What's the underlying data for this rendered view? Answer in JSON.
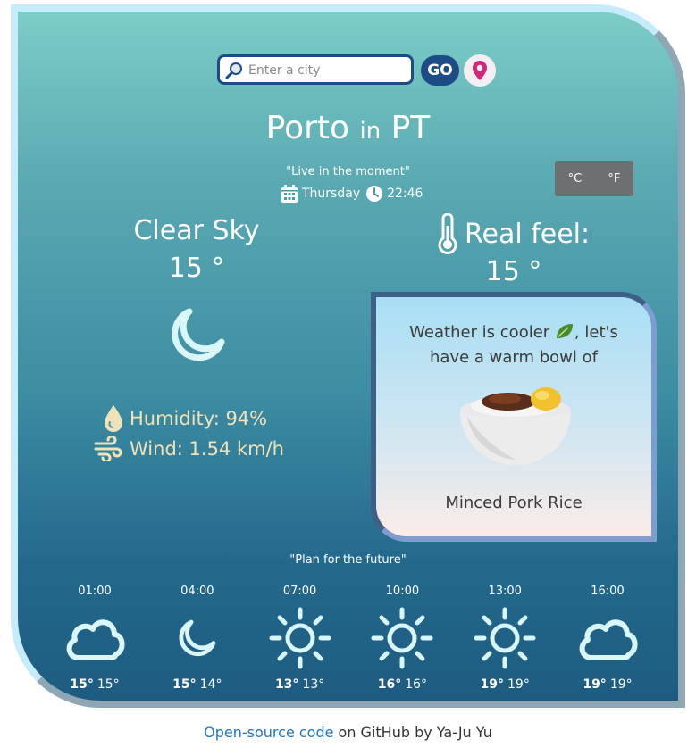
{
  "search": {
    "placeholder": "Enter a city",
    "go_label": "GO"
  },
  "location": {
    "city": "Porto",
    "connector": "in",
    "country": "PT"
  },
  "quote_now": "\"Live in the moment\"",
  "date": {
    "day": "Thursday",
    "time": "22:46"
  },
  "units": {
    "celsius": "°C",
    "fahrenheit": "°F"
  },
  "current": {
    "description": "Clear Sky",
    "temperature": "15 °",
    "icon": "moon-icon",
    "humidity": "Humidity: 94%",
    "wind": "Wind: 1.54 km/h",
    "real_feel_label": "Real feel:",
    "real_feel_temp": "15 °"
  },
  "food": {
    "message_part1": "Weather is cooler",
    "message_part2": ", let's",
    "message_line2": "have a warm bowl of",
    "dish": "Minced Pork Rice"
  },
  "quote_future": "\"Plan for the future\"",
  "forecast": [
    {
      "time": "01:00",
      "max": "15°",
      "min": "15°",
      "icon": "cloud-icon"
    },
    {
      "time": "04:00",
      "max": "15°",
      "min": "14°",
      "icon": "moon-icon"
    },
    {
      "time": "07:00",
      "max": "13°",
      "min": "13°",
      "icon": "sun-icon"
    },
    {
      "time": "10:00",
      "max": "16°",
      "min": "16°",
      "icon": "sun-icon"
    },
    {
      "time": "13:00",
      "max": "19°",
      "min": "19°",
      "icon": "sun-icon"
    },
    {
      "time": "16:00",
      "max": "19°",
      "min": "19°",
      "icon": "cloud-icon"
    }
  ],
  "footer": {
    "link_text": "Open-source code",
    "rest": " on GitHub by Ya-Ju Yu"
  },
  "colors": {
    "accent": "#1d4b86",
    "detail_text": "#efe2b8",
    "link": "#1f76c2"
  }
}
